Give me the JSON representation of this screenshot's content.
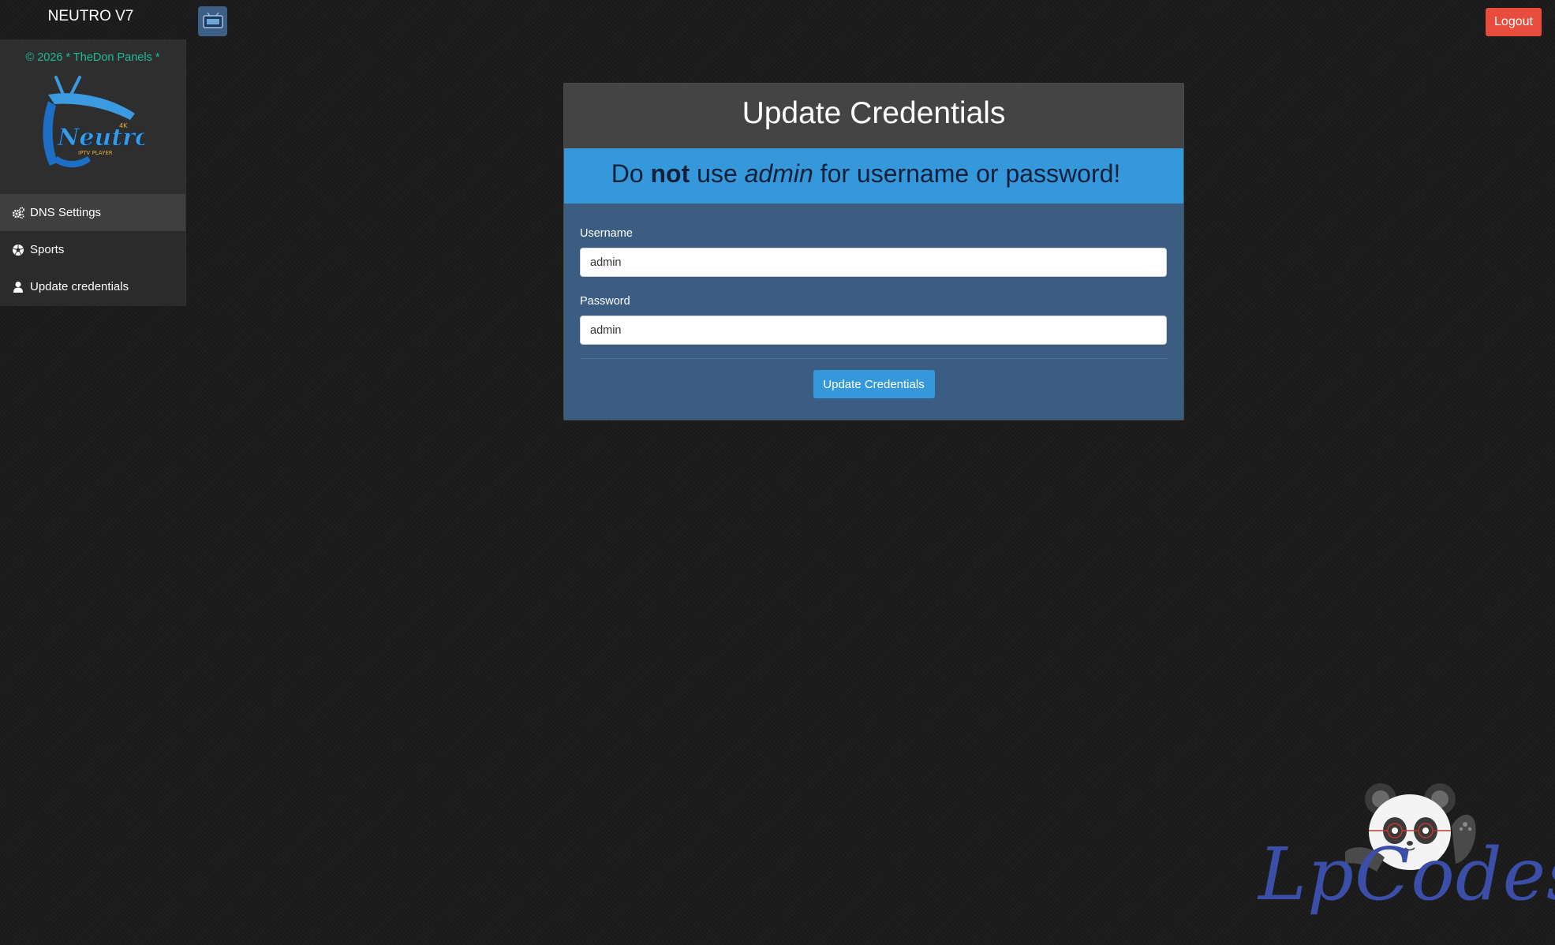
{
  "header": {
    "brand": "NEUTRO V7",
    "logout_label": "Logout"
  },
  "sidebar": {
    "copyright": "© 2026 * TheDon Panels *",
    "logo_alt": "Neutro IPTV Player",
    "items": [
      {
        "label": "DNS Settings",
        "icon": "gears-icon",
        "active": true
      },
      {
        "label": "Sports",
        "icon": "soccer-ball-icon",
        "active": false
      },
      {
        "label": "Update credentials",
        "icon": "user-icon",
        "active": false
      }
    ]
  },
  "panel": {
    "title": "Update Credentials",
    "warning": {
      "prefix": "Do ",
      "bold": "not",
      "middle": " use ",
      "italic": "admin",
      "suffix": " for username or password!"
    },
    "username_label": "Username",
    "username_value": "admin",
    "password_label": "Password",
    "password_value": "admin",
    "submit_label": "Update Credentials"
  },
  "watermark": {
    "text": "LpCodes"
  },
  "colors": {
    "logout": "#e74c3c",
    "accent": "#3498db",
    "panel_body": "#3b5d82",
    "copyright": "#1abc9c"
  }
}
